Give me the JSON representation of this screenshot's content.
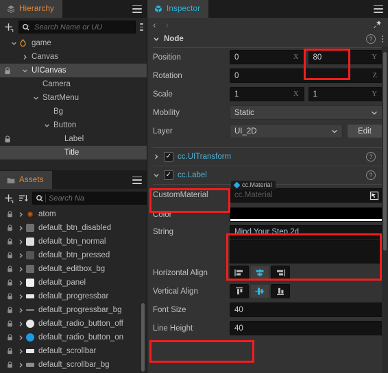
{
  "hierarchy": {
    "tab_label": "Hierarchy",
    "search_placeholder": "Search Name or UU",
    "search_value": "",
    "items": [
      {
        "name": "game",
        "indent": 0,
        "arrow": "down",
        "locked": false,
        "selected": false,
        "icon": "flame-icon"
      },
      {
        "name": "Canvas",
        "indent": 1,
        "arrow": "right",
        "locked": false,
        "selected": false,
        "icon": ""
      },
      {
        "name": "UICanvas",
        "indent": 1,
        "arrow": "down",
        "locked": true,
        "selected": true,
        "icon": ""
      },
      {
        "name": "Camera",
        "indent": 2,
        "arrow": "none",
        "locked": false,
        "selected": false,
        "icon": ""
      },
      {
        "name": "StartMenu",
        "indent": 2,
        "arrow": "down",
        "locked": false,
        "selected": false,
        "icon": ""
      },
      {
        "name": "Bg",
        "indent": 3,
        "arrow": "none",
        "locked": false,
        "selected": false,
        "icon": ""
      },
      {
        "name": "Button",
        "indent": 3,
        "arrow": "down",
        "locked": false,
        "selected": false,
        "icon": ""
      },
      {
        "name": "Label",
        "indent": 4,
        "arrow": "none",
        "locked": true,
        "selected": false,
        "icon": ""
      },
      {
        "name": "Title",
        "indent": 4,
        "arrow": "none",
        "locked": false,
        "selected": true,
        "icon": ""
      }
    ]
  },
  "assets": {
    "tab_label": "Assets",
    "search_placeholder": "Search Na",
    "search_value": "",
    "items": [
      {
        "name": "atom",
        "swatch": "#d4762a",
        "shape": "dot"
      },
      {
        "name": "default_btn_disabled",
        "swatch": "#6f6f6f",
        "shape": "square"
      },
      {
        "name": "default_btn_normal",
        "swatch": "#dedede",
        "shape": "square"
      },
      {
        "name": "default_btn_pressed",
        "swatch": "#555555",
        "shape": "square"
      },
      {
        "name": "default_editbox_bg",
        "swatch": "#6a6a6a",
        "shape": "square"
      },
      {
        "name": "default_panel",
        "swatch": "#f2f2f2",
        "shape": "square"
      },
      {
        "name": "default_progressbar",
        "swatch": "#e8e8e8",
        "shape": "bar"
      },
      {
        "name": "default_progressbar_bg",
        "swatch": "#8d8d8d",
        "shape": "thinbar"
      },
      {
        "name": "default_radio_button_off",
        "swatch": "#e8e8e8",
        "shape": "circle"
      },
      {
        "name": "default_radio_button_on",
        "swatch": "#1e9ae0",
        "shape": "circle"
      },
      {
        "name": "default_scrollbar",
        "swatch": "#e8e8e8",
        "shape": "bar"
      },
      {
        "name": "default_scrollbar_bg",
        "swatch": "#8d8d8d",
        "shape": "bar"
      }
    ]
  },
  "inspector": {
    "tab_label": "Inspector",
    "node_section": {
      "title": "Node",
      "properties": {
        "position_label": "Position",
        "position_x": "0",
        "position_y": "80",
        "axis_x": "X",
        "axis_y": "Y",
        "axis_z": "Z",
        "rotation_label": "Rotation",
        "rotation_z": "0",
        "scale_label": "Scale",
        "scale_x": "1",
        "scale_y": "1",
        "mobility_label": "Mobility",
        "mobility_value": "Static",
        "layer_label": "Layer",
        "layer_value": "UI_2D",
        "layer_edit_button": "Edit"
      }
    },
    "components": [
      {
        "name": "cc.UITransform",
        "expanded": false,
        "enabled": true
      },
      {
        "name": "cc.Label",
        "expanded": true,
        "enabled": true
      }
    ],
    "label_component": {
      "custom_material_label": "CustomMaterial",
      "custom_material_value": "cc.Material",
      "custom_material_tag": "cc.Material",
      "color_label": "Color",
      "color_value": "#000000",
      "string_label": "String",
      "string_value": "Mind Your Step 2d",
      "horizontal_align_label": "Horizontal Align",
      "horizontal_align_selected": 1,
      "horizontal_align_options": [
        "left",
        "center",
        "right"
      ],
      "vertical_align_label": "Vertical Align",
      "vertical_align_selected": 1,
      "vertical_align_options": [
        "top",
        "middle",
        "bottom"
      ],
      "font_size_label": "Font Size",
      "font_size_value": "40",
      "line_height_label": "Line Height",
      "line_height_value": "40"
    }
  },
  "annotations": {
    "color": "#f41d1d",
    "boxes": [
      {
        "name": "position-y-highlight"
      },
      {
        "name": "cc-label-header-highlight"
      },
      {
        "name": "color-string-highlight"
      },
      {
        "name": "font-size-highlight"
      }
    ]
  }
}
